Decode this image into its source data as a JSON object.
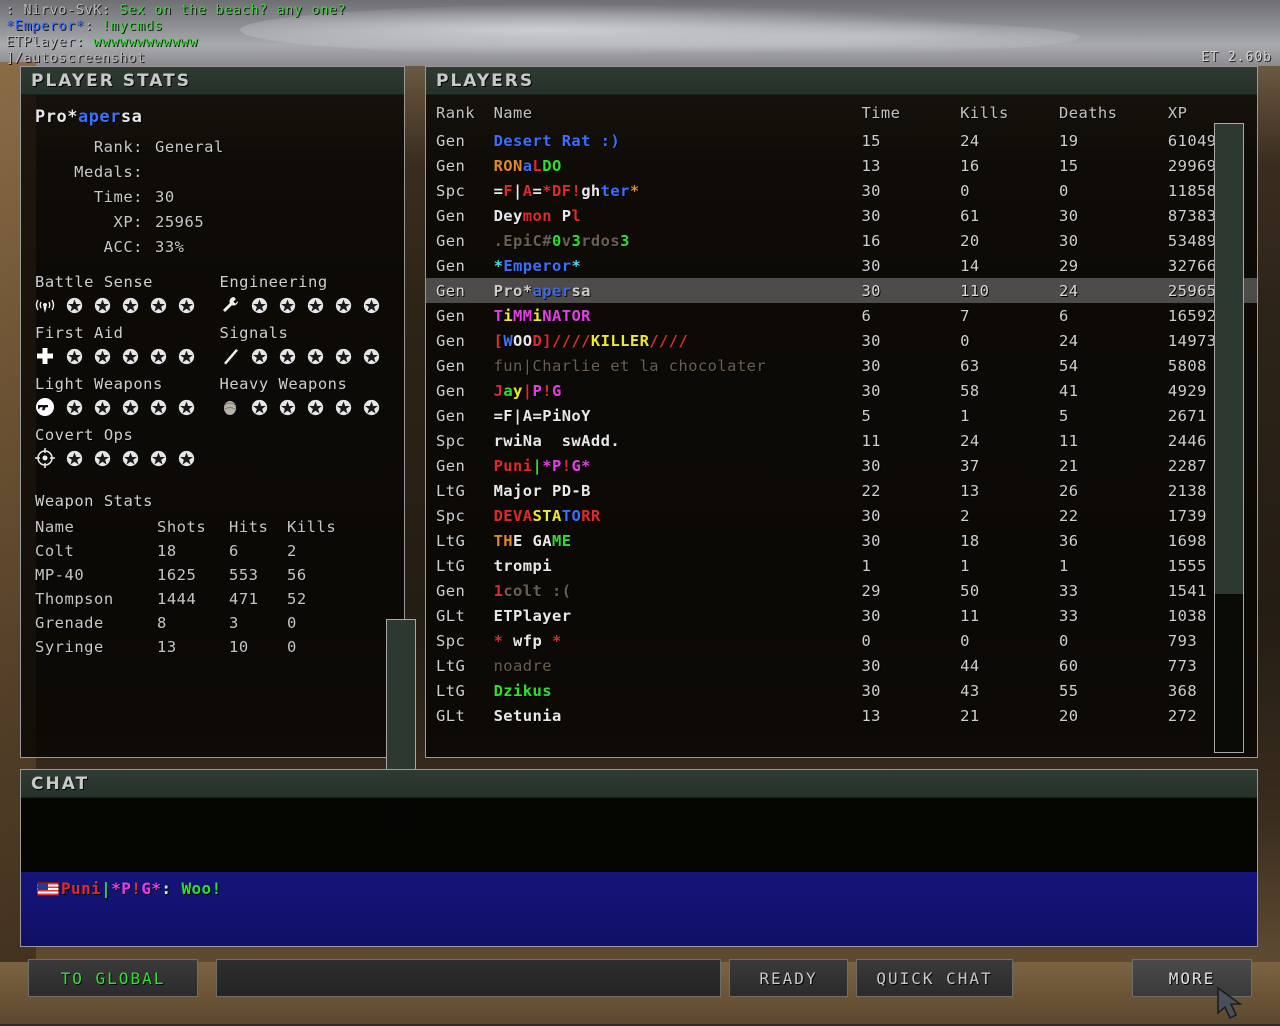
{
  "version_label": "ET 2.60b",
  "console": {
    "lines": [
      [
        {
          "t": ": Nirvo-SvK: ",
          "c": "c-grey"
        },
        {
          "t": "Sex on the beach? any one?",
          "c": "c-green"
        }
      ],
      [
        {
          "t": "*Emperor*",
          "c": "c-blue"
        },
        {
          "t": ": ",
          "c": "c-grey"
        },
        {
          "t": "!mycmds",
          "c": "c-green"
        }
      ],
      [
        {
          "t": "ETPlayer: ",
          "c": "c-grey"
        },
        {
          "t": "wwwwwwwwwwww",
          "c": "c-ltgreen"
        }
      ],
      [
        {
          "t": "]/autoscreenshot",
          "c": "c-grey"
        }
      ]
    ]
  },
  "stats": {
    "title": "PLAYER STATS",
    "player_name": [
      {
        "t": "Pro*",
        "c": "c-white"
      },
      {
        "t": "aper",
        "c": "c-blue"
      },
      {
        "t": "sa",
        "c": "c-white"
      }
    ],
    "fields": [
      {
        "key": "Rank:",
        "value": "General"
      },
      {
        "key": "Medals:",
        "value": ""
      },
      {
        "key": "Time:",
        "value": "30"
      },
      {
        "key": "XP:",
        "value": "25965"
      },
      {
        "key": "ACC:",
        "value": "33%"
      }
    ],
    "skills": [
      {
        "label": "Battle Sense",
        "icon": "battle-sense-icon",
        "stars": 5
      },
      {
        "label": "Engineering",
        "icon": "wrench-icon",
        "stars": 5
      },
      {
        "label": "First Aid",
        "icon": "medic-cross-icon",
        "stars": 5
      },
      {
        "label": "Signals",
        "icon": "signals-icon",
        "stars": 5
      },
      {
        "label": "Light Weapons",
        "icon": "pistol-icon",
        "stars": 5
      },
      {
        "label": "Heavy Weapons",
        "icon": "heavy-weapons-icon",
        "stars": 5
      },
      {
        "label": "Covert Ops",
        "icon": "crosshair-icon",
        "stars": 5
      }
    ],
    "weapon_stats": {
      "title": "Weapon Stats",
      "headers": [
        "Name",
        "Shots",
        "Hits",
        "Kills"
      ],
      "rows": [
        {
          "name": "Colt",
          "shots": "18",
          "hits": "6",
          "kills": "2"
        },
        {
          "name": "MP-40",
          "shots": "1625",
          "hits": "553",
          "kills": "56"
        },
        {
          "name": "Thompson",
          "shots": "1444",
          "hits": "471",
          "kills": "52"
        },
        {
          "name": "Grenade",
          "shots": "8",
          "hits": "3",
          "kills": "0"
        },
        {
          "name": "Syringe",
          "shots": "13",
          "hits": "10",
          "kills": "0"
        }
      ]
    }
  },
  "players": {
    "title": "PLAYERS",
    "headers": {
      "rank": "Rank",
      "name": "Name",
      "time": "Time",
      "kills": "Kills",
      "deaths": "Deaths",
      "xp": "XP"
    },
    "rows": [
      {
        "rank": "Gen",
        "name_parts": [
          {
            "t": "Desert Rat :)",
            "c": "c-blue"
          }
        ],
        "time": "15",
        "kills": "24",
        "deaths": "19",
        "xp": "61049",
        "me": false
      },
      {
        "rank": "Gen",
        "name_parts": [
          {
            "t": "RON",
            "c": "c-orange"
          },
          {
            "t": "a",
            "c": "c-blue"
          },
          {
            "t": "L",
            "c": "c-red"
          },
          {
            "t": "DO",
            "c": "c-ltgreen"
          }
        ],
        "time": "13",
        "kills": "16",
        "deaths": "15",
        "xp": "29969",
        "me": false
      },
      {
        "rank": "Spc",
        "name_parts": [
          {
            "t": "=",
            "c": "c-white"
          },
          {
            "t": "F",
            "c": "c-red"
          },
          {
            "t": "|",
            "c": "c-white"
          },
          {
            "t": "A",
            "c": "c-red"
          },
          {
            "t": "=",
            "c": "c-white"
          },
          {
            "t": "*DF",
            "c": "c-red"
          },
          {
            "t": "!",
            "c": "c-red"
          },
          {
            "t": "gh",
            "c": "c-white"
          },
          {
            "t": "ter",
            "c": "c-blue"
          },
          {
            "t": "*",
            "c": "c-orange"
          }
        ],
        "time": "30",
        "kills": "0",
        "deaths": "0",
        "xp": "11858",
        "me": false
      },
      {
        "rank": "Gen",
        "name_parts": [
          {
            "t": "Dey",
            "c": "c-white"
          },
          {
            "t": "mon",
            "c": "c-red"
          },
          {
            "t": " P",
            "c": "c-white"
          },
          {
            "t": "l",
            "c": "c-red"
          }
        ],
        "time": "30",
        "kills": "61",
        "deaths": "30",
        "xp": "87383",
        "me": false
      },
      {
        "rank": "Gen",
        "name_parts": [
          {
            "t": ".EpiC#",
            "c": "c-dim"
          },
          {
            "t": "0",
            "c": "c-ltgreen"
          },
          {
            "t": "v",
            "c": "c-dim"
          },
          {
            "t": "3",
            "c": "c-ltgreen"
          },
          {
            "t": "rdos",
            "c": "c-dim"
          },
          {
            "t": "3",
            "c": "c-ltgreen"
          }
        ],
        "time": "16",
        "kills": "20",
        "deaths": "30",
        "xp": "53489",
        "me": false
      },
      {
        "rank": "Gen",
        "name_parts": [
          {
            "t": "*",
            "c": "c-cyan"
          },
          {
            "t": "Emp",
            "c": "c-blue"
          },
          {
            "t": "er",
            "c": "c-blue"
          },
          {
            "t": "or",
            "c": "c-blue"
          },
          {
            "t": "*",
            "c": "c-cyan"
          }
        ],
        "time": "30",
        "kills": "14",
        "deaths": "29",
        "xp": "32766",
        "me": false
      },
      {
        "rank": "Gen",
        "name_parts": [
          {
            "t": "Pro*",
            "c": "c-white"
          },
          {
            "t": "aper",
            "c": "c-blue"
          },
          {
            "t": "sa",
            "c": "c-white"
          }
        ],
        "time": "30",
        "kills": "110",
        "deaths": "24",
        "xp": "25965",
        "me": true
      },
      {
        "rank": "Gen",
        "name_parts": [
          {
            "t": "T",
            "c": "c-magenta"
          },
          {
            "t": "i",
            "c": "c-yellow"
          },
          {
            "t": "MM",
            "c": "c-magenta"
          },
          {
            "t": "i",
            "c": "c-yellow"
          },
          {
            "t": "NATOR",
            "c": "c-magenta"
          }
        ],
        "time": "6",
        "kills": "7",
        "deaths": "6",
        "xp": "16592",
        "me": false
      },
      {
        "rank": "Gen",
        "name_parts": [
          {
            "t": "[",
            "c": "c-red"
          },
          {
            "t": "W",
            "c": "c-blue"
          },
          {
            "t": "OO",
            "c": "c-white"
          },
          {
            "t": "D",
            "c": "c-red"
          },
          {
            "t": "]////",
            "c": "c-red"
          },
          {
            "t": "KILLER",
            "c": "c-yellow"
          },
          {
            "t": "////",
            "c": "c-red"
          }
        ],
        "time": "30",
        "kills": "0",
        "deaths": "24",
        "xp": "14973",
        "me": false
      },
      {
        "rank": "Gen",
        "name_parts": [
          {
            "t": "fun|Charlie et la chocolater",
            "c": "c-dim"
          }
        ],
        "time": "30",
        "kills": "63",
        "deaths": "54",
        "xp": "5808",
        "me": false
      },
      {
        "rank": "Gen",
        "name_parts": [
          {
            "t": "J",
            "c": "c-red"
          },
          {
            "t": "a",
            "c": "c-ltgreen"
          },
          {
            "t": "y",
            "c": "c-yellow"
          },
          {
            "t": "|",
            "c": "c-red"
          },
          {
            "t": "P",
            "c": "c-magenta"
          },
          {
            "t": "!",
            "c": "c-red"
          },
          {
            "t": "G",
            "c": "c-magenta"
          }
        ],
        "time": "30",
        "kills": "58",
        "deaths": "41",
        "xp": "4929",
        "me": false
      },
      {
        "rank": "Gen",
        "name_parts": [
          {
            "t": "=F|A=PiNoY",
            "c": "c-white"
          }
        ],
        "time": "5",
        "kills": "1",
        "deaths": "5",
        "xp": "2671",
        "me": false
      },
      {
        "rank": "Spc",
        "name_parts": [
          {
            "t": "rwiNa  swAdd.",
            "c": "c-white"
          }
        ],
        "time": "11",
        "kills": "24",
        "deaths": "11",
        "xp": "2446",
        "me": false
      },
      {
        "rank": "Gen",
        "name_parts": [
          {
            "t": "Puni",
            "c": "c-red"
          },
          {
            "t": "|",
            "c": "c-ltgreen"
          },
          {
            "t": "*P",
            "c": "c-magenta"
          },
          {
            "t": "!",
            "c": "c-red"
          },
          {
            "t": "G*",
            "c": "c-magenta"
          }
        ],
        "time": "30",
        "kills": "37",
        "deaths": "21",
        "xp": "2287",
        "me": false
      },
      {
        "rank": "LtG",
        "name_parts": [
          {
            "t": "Major PD-B",
            "c": "c-white"
          }
        ],
        "time": "22",
        "kills": "13",
        "deaths": "26",
        "xp": "2138",
        "me": false
      },
      {
        "rank": "Spc",
        "name_parts": [
          {
            "t": "DEVA",
            "c": "c-red"
          },
          {
            "t": "STA",
            "c": "c-yellow"
          },
          {
            "t": "TO",
            "c": "c-blue"
          },
          {
            "t": "RR",
            "c": "c-red"
          }
        ],
        "time": "30",
        "kills": "2",
        "deaths": "22",
        "xp": "1739",
        "me": false
      },
      {
        "rank": "LtG",
        "name_parts": [
          {
            "t": "TH",
            "c": "c-orange"
          },
          {
            "t": "E GA",
            "c": "c-white"
          },
          {
            "t": "ME",
            "c": "c-ltgreen"
          }
        ],
        "time": "30",
        "kills": "18",
        "deaths": "36",
        "xp": "1698",
        "me": false
      },
      {
        "rank": "LtG",
        "name_parts": [
          {
            "t": "trompi",
            "c": "c-white"
          }
        ],
        "time": "1",
        "kills": "1",
        "deaths": "1",
        "xp": "1555",
        "me": false
      },
      {
        "rank": "Gen",
        "name_parts": [
          {
            "t": "1",
            "c": "c-red"
          },
          {
            "t": "colt :(",
            "c": "c-dim"
          }
        ],
        "time": "29",
        "kills": "50",
        "deaths": "33",
        "xp": "1541",
        "me": false
      },
      {
        "rank": "GLt",
        "name_parts": [
          {
            "t": "ETPlayer",
            "c": "c-white"
          }
        ],
        "time": "30",
        "kills": "11",
        "deaths": "33",
        "xp": "1038",
        "me": false
      },
      {
        "rank": "Spc",
        "name_parts": [
          {
            "t": "*",
            "c": "c-red"
          },
          {
            "t": " wfp ",
            "c": "c-white"
          },
          {
            "t": "*",
            "c": "c-red"
          }
        ],
        "time": "0",
        "kills": "0",
        "deaths": "0",
        "xp": "793",
        "me": false
      },
      {
        "rank": "LtG",
        "name_parts": [
          {
            "t": "noadre",
            "c": "c-dim"
          }
        ],
        "time": "30",
        "kills": "44",
        "deaths": "60",
        "xp": "773",
        "me": false
      },
      {
        "rank": "LtG",
        "name_parts": [
          {
            "t": "Dzikus",
            "c": "c-ltgreen"
          }
        ],
        "time": "30",
        "kills": "43",
        "deaths": "55",
        "xp": "368",
        "me": false
      },
      {
        "rank": "GLt",
        "name_parts": [
          {
            "t": "Setunia",
            "c": "c-white"
          }
        ],
        "time": "13",
        "kills": "21",
        "deaths": "20",
        "xp": "272",
        "me": false
      }
    ]
  },
  "chat": {
    "title": "CHAT",
    "messages": [
      {
        "flag": "us-flag-icon",
        "parts": [
          {
            "t": "Puni",
            "c": "c-red"
          },
          {
            "t": "|",
            "c": "c-ltgreen"
          },
          {
            "t": "*P",
            "c": "c-magenta"
          },
          {
            "t": "!",
            "c": "c-red"
          },
          {
            "t": "G*",
            "c": "c-magenta"
          },
          {
            "t": ": ",
            "c": "c-white"
          },
          {
            "t": "Woo!",
            "c": "c-ltgreen"
          }
        ]
      }
    ]
  },
  "buttons": {
    "to_global": "TO GLOBAL",
    "chat_input_value": "",
    "ready": "READY",
    "quick_chat": "QUICK CHAT",
    "more": "MORE"
  }
}
